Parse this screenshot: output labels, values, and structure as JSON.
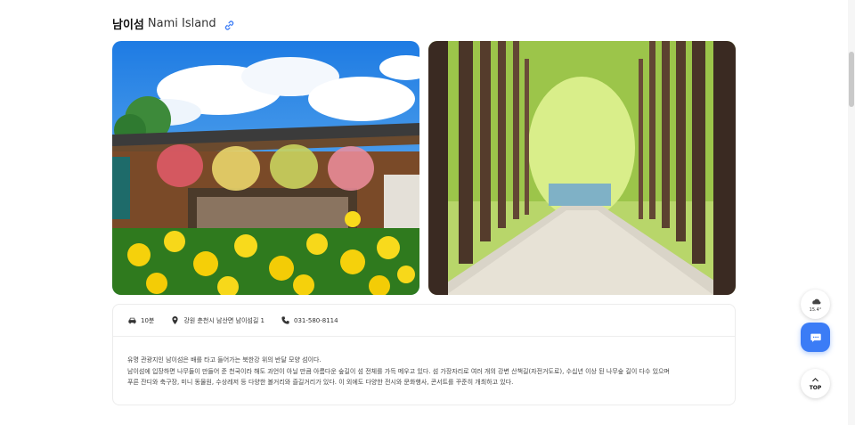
{
  "header": {
    "title_ko": "남이섬",
    "title_en": "Nami Island"
  },
  "info": {
    "travel_time": "10분",
    "address": "강원 춘천시 남산면 남이섬길 1",
    "phone": "031-580-8114"
  },
  "description": [
    "유명 관광지인 남이섬은 배를 타고 들어가는 북한강 위의 반달 모양 섬이다.",
    "남이섬에 입장하면 나무들이 만들어 준 천국이라 해도 과언이 아닐 만큼 아름다운 숲길이 섬 전체를 가득 메우고 있다. 섬 가장자리로 여러 개의 강변 산책길(자전거도로), 수십년 이상 된 나무숲 길이 다수 있으며",
    "푸른 잔디와 축구장, 미니 동물원, 수상레저 등 다양한 볼거리와 즐길거리가 있다. 이 외에도 다양한 전시와 문화행사, 콘서트를 꾸준히 개최하고 있다."
  ],
  "floating": {
    "weather_temp": "15.4°",
    "top_label": "TOP"
  },
  "colors": {
    "accent": "#3b7cf6",
    "link_icon": "#3b7cf6"
  },
  "icons": [
    "link-icon",
    "car-icon",
    "location-pin-icon",
    "phone-icon",
    "weather-icon",
    "chat-icon",
    "arrow-up-icon"
  ]
}
